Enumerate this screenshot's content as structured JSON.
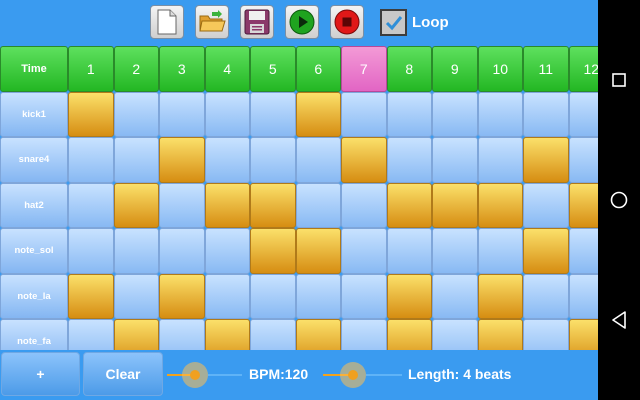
{
  "toolbar": {
    "loop_label": "Loop",
    "loop_checked": true
  },
  "grid": {
    "time_label": "Time",
    "steps": [
      "1",
      "2",
      "3",
      "4",
      "5",
      "6",
      "7",
      "8",
      "9",
      "10",
      "11",
      "12"
    ],
    "active_step": "7",
    "tracks": [
      {
        "name": "kick1",
        "pattern": [
          1,
          0,
          0,
          0,
          0,
          1,
          0,
          0,
          0,
          0,
          0,
          0
        ]
      },
      {
        "name": "snare4",
        "pattern": [
          0,
          0,
          1,
          0,
          0,
          0,
          1,
          0,
          0,
          0,
          1,
          0
        ]
      },
      {
        "name": "hat2",
        "pattern": [
          0,
          1,
          0,
          1,
          1,
          0,
          0,
          1,
          1,
          1,
          0,
          1
        ]
      },
      {
        "name": "note_sol",
        "pattern": [
          0,
          0,
          0,
          0,
          1,
          1,
          0,
          0,
          0,
          0,
          1,
          0
        ]
      },
      {
        "name": "note_la",
        "pattern": [
          1,
          0,
          1,
          0,
          0,
          0,
          0,
          1,
          0,
          1,
          0,
          0
        ]
      },
      {
        "name": "note_fa",
        "pattern": [
          0,
          1,
          0,
          1,
          0,
          1,
          0,
          1,
          0,
          1,
          0,
          1
        ]
      }
    ]
  },
  "bottom": {
    "add_label": "+",
    "clear_label": "Clear",
    "bpm_label": "BPM:120",
    "length_label": "Length: 4 beats"
  },
  "colors": {
    "background": "#3a9bf0",
    "active_step": "#e265c4",
    "step_on": "#d68d12",
    "header": "#23b723"
  }
}
